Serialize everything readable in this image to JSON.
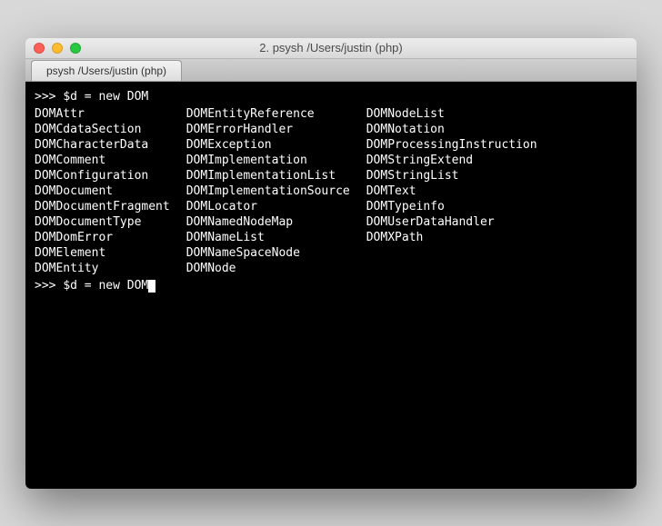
{
  "window": {
    "title": "2. psysh  /Users/justin (php)"
  },
  "tab": {
    "label": "psysh  /Users/justin (php)"
  },
  "terminal": {
    "prompt_prefix": ">>> ",
    "line1": "$d = new DOM",
    "line2": "$d = new DOM",
    "completions": {
      "col1": [
        "DOMAttr",
        "DOMCdataSection",
        "DOMCharacterData",
        "DOMComment",
        "DOMConfiguration",
        "DOMDocument",
        "DOMDocumentFragment",
        "DOMDocumentType",
        "DOMDomError",
        "DOMElement",
        "DOMEntity"
      ],
      "col2": [
        "DOMEntityReference",
        "DOMErrorHandler",
        "DOMException",
        "DOMImplementation",
        "DOMImplementationList",
        "DOMImplementationSource",
        "DOMLocator",
        "DOMNamedNodeMap",
        "DOMNameList",
        "DOMNameSpaceNode",
        "DOMNode"
      ],
      "col3": [
        "DOMNodeList",
        "DOMNotation",
        "DOMProcessingInstruction",
        "DOMStringExtend",
        "DOMStringList",
        "DOMText",
        "DOMTypeinfo",
        "DOMUserDataHandler",
        "DOMXPath"
      ]
    }
  }
}
